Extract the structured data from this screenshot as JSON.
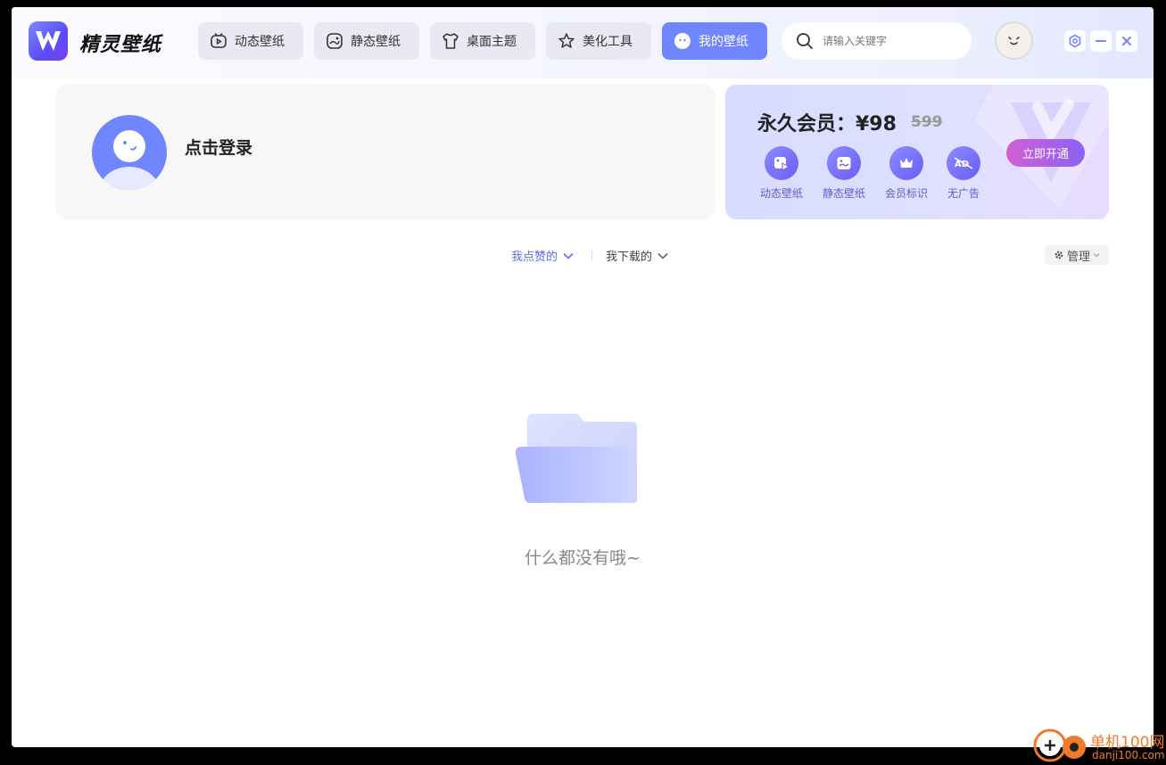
{
  "app": {
    "brand": "精灵壁纸"
  },
  "nav": {
    "tabs": [
      {
        "label": "动态壁纸",
        "icon": "tv-icon"
      },
      {
        "label": "静态壁纸",
        "icon": "image-icon"
      },
      {
        "label": "桌面主题",
        "icon": "shirt-icon"
      },
      {
        "label": "美化工具",
        "icon": "star-icon"
      },
      {
        "label": "我的壁纸",
        "icon": "face-icon",
        "active": true
      }
    ]
  },
  "search": {
    "placeholder": "请输入关键字"
  },
  "user": {
    "login_label": "点击登录"
  },
  "vip": {
    "title": "永久会员：¥98",
    "old_price": "599",
    "perks": [
      {
        "label": "动态壁纸",
        "icon": "dynamic-wallpaper-icon"
      },
      {
        "label": "静态壁纸",
        "icon": "static-wallpaper-icon"
      },
      {
        "label": "会员标识",
        "icon": "crown-icon"
      },
      {
        "label": "无广告",
        "icon": "no-ads-icon"
      }
    ],
    "open_label": "立即开通"
  },
  "filters": {
    "liked": "我点赞的",
    "downloaded": "我下载的",
    "manage": "管理"
  },
  "empty": {
    "message": "什么都没有哦~"
  },
  "watermark": {
    "site_cn": "单机100网",
    "site_url": "danji100.com"
  },
  "colors": {
    "accent": "#6f86ff",
    "vip_button_start": "#d35fd3",
    "vip_button_end": "#8a63f5"
  }
}
